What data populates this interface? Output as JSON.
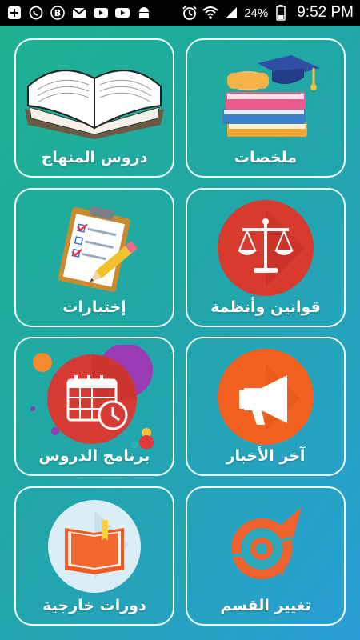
{
  "status_bar": {
    "battery": "24%",
    "time": "9:52 PM",
    "icons": [
      "add-icon",
      "whatsapp-icon",
      "bitcoin-icon",
      "gmail-icon",
      "youtube-icon",
      "youtube-icon",
      "android-icon",
      "alarm-icon",
      "wifi-icon",
      "signal-icon",
      "battery-icon"
    ]
  },
  "menu": {
    "items": [
      {
        "label": "دروس المنهاج",
        "icon": "open-book-icon"
      },
      {
        "label": "ملخصات",
        "icon": "books-graduation-cap-icon"
      },
      {
        "label": "إختبارات",
        "icon": "clipboard-test-icon"
      },
      {
        "label": "قوانين وأنظمة",
        "icon": "scales-icon"
      },
      {
        "label": "برنامج الدروس",
        "icon": "calendar-clock-icon"
      },
      {
        "label": "آخر الأخبار",
        "icon": "megaphone-icon"
      },
      {
        "label": "دورات خارجية",
        "icon": "book-icon"
      },
      {
        "label": "تغيير القسم",
        "icon": "compass-icon"
      }
    ]
  },
  "colors": {
    "background_start": "#1fb38f",
    "background_end": "#2a9fd6",
    "scales_circle": "#d93a2e",
    "megaphone_circle": "#f2611f",
    "calendar_circle": "#d63a34",
    "book_circle": "#dbeef5"
  }
}
